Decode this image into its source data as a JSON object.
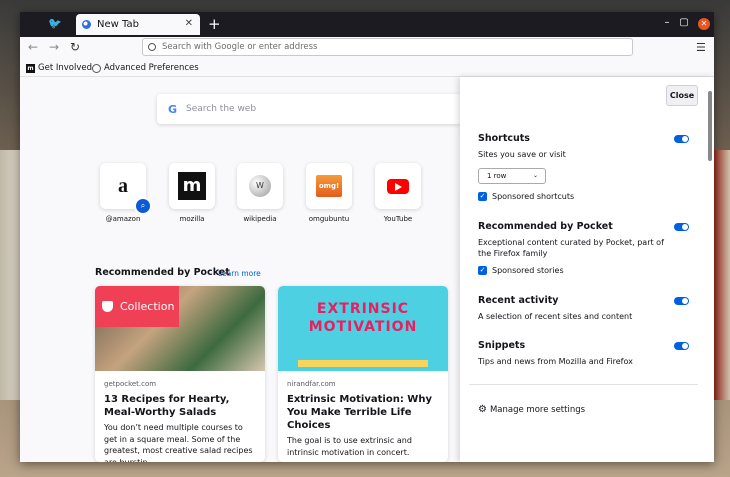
{
  "browser": {
    "tab_title": "New Tab",
    "url_placeholder": "Search with Google or enter address"
  },
  "bookmarks": [
    {
      "label": "Get Involved"
    },
    {
      "label": "Advanced Preferences"
    }
  ],
  "newtab": {
    "search_placeholder": "Search the web",
    "shortcuts": [
      {
        "label": "@amazon",
        "icon": "amazon-icon"
      },
      {
        "label": "mozilla",
        "icon": "mozilla-icon"
      },
      {
        "label": "wikipedia",
        "icon": "wikipedia-icon"
      },
      {
        "label": "omgubuntu",
        "icon": "omgubuntu-icon"
      },
      {
        "label": "YouTube",
        "icon": "youtube-icon"
      }
    ],
    "pocket": {
      "heading": "Recommended by Pocket",
      "learn_more": "Learn more",
      "cards": [
        {
          "badge": "Collection",
          "source": "getpocket.com",
          "title": "13 Recipes for Hearty, Meal-Worthy Salads",
          "desc": "You don’t need multiple courses to get in a square meal. Some of the greatest, most creative salad recipes are burstin…"
        },
        {
          "image_text": "EXTRINSIC MOTIVATION",
          "source": "nirandfar.com",
          "title": "Extrinsic Motivation: Why You Make Terrible Life Choices",
          "desc": "The goal is to use extrinsic and intrinsic motivation in concert."
        }
      ]
    }
  },
  "panel": {
    "close_label": "Close",
    "shortcuts": {
      "title": "Shortcuts",
      "desc": "Sites you save or visit",
      "rows": "1 row",
      "sponsored": "Sponsored shortcuts"
    },
    "pocket": {
      "title": "Recommended by Pocket",
      "desc": "Exceptional content curated by Pocket, part of the Firefox family",
      "sponsored": "Sponsored stories"
    },
    "recent": {
      "title": "Recent activity",
      "desc": "A selection of recent sites and content"
    },
    "snippets": {
      "title": "Snippets",
      "desc": "Tips and news from Mozilla and Firefox"
    },
    "manage": "Manage more settings"
  },
  "colors": {
    "accent": "#0061e0",
    "titlebar": "#1c1b22",
    "collection": "#ef4056"
  }
}
